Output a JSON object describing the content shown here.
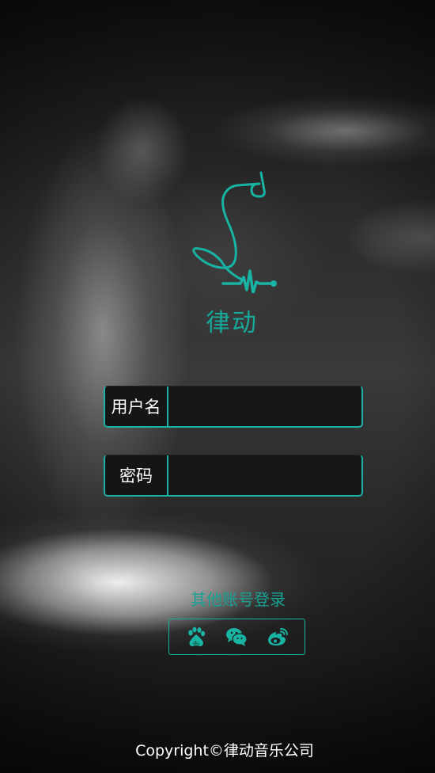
{
  "app": {
    "name": "律动",
    "accent_color": "#19b3a3"
  },
  "login_form": {
    "username": {
      "label": "用户名",
      "value": "",
      "placeholder": ""
    },
    "password": {
      "label": "密码",
      "value": "",
      "placeholder": ""
    }
  },
  "other_login": {
    "title": "其他账号登录",
    "providers": [
      {
        "icon": "baidu-icon"
      },
      {
        "icon": "wechat-icon"
      },
      {
        "icon": "weibo-icon"
      }
    ]
  },
  "footer": {
    "copyright": "Copyright©律动音乐公司"
  }
}
